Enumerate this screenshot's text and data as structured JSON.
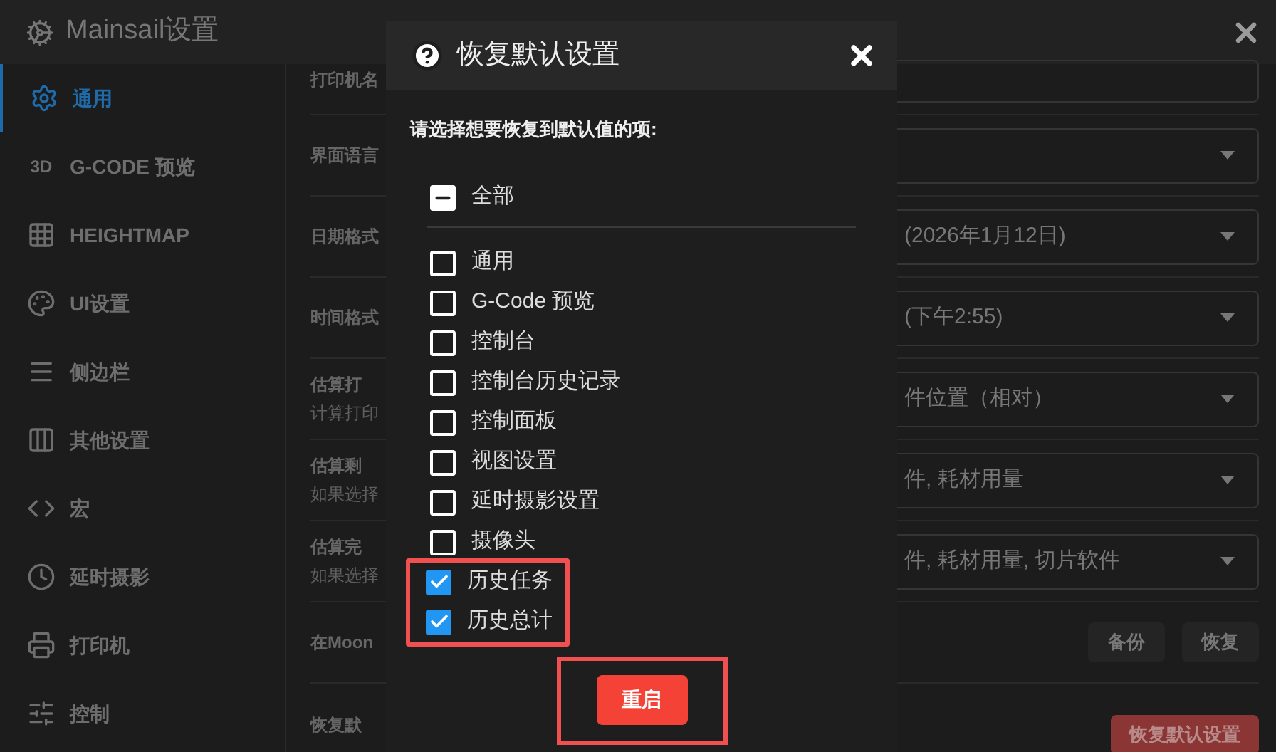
{
  "window": {
    "title": "Mainsail设置"
  },
  "sidebar": {
    "items": [
      {
        "label": "通用",
        "selected": true
      },
      {
        "label": "G-CODE 预览",
        "icon_text": "3D",
        "selected": false
      },
      {
        "label": "HEIGHTMAP",
        "selected": false
      },
      {
        "label": "UI设置",
        "selected": false
      },
      {
        "label": "侧边栏",
        "selected": false
      },
      {
        "label": "其他设置",
        "selected": false
      },
      {
        "label": "宏",
        "selected": false
      },
      {
        "label": "延时摄影",
        "selected": false
      },
      {
        "label": "打印机",
        "selected": false
      },
      {
        "label": "控制",
        "selected": false
      }
    ]
  },
  "settings": {
    "rows": [
      {
        "kind": "text",
        "label": "打印机名"
      },
      {
        "kind": "select",
        "label": "界面语言"
      },
      {
        "kind": "select",
        "label": "日期格式",
        "value": "(2026年1月12日)"
      },
      {
        "kind": "select",
        "label": "时间格式",
        "value": "(下午2:55)"
      },
      {
        "kind": "select",
        "label": "估算打",
        "sublabel": "计算打印",
        "value": "件位置（相对）"
      },
      {
        "kind": "select",
        "label": "估算剩",
        "sublabel": "如果选择",
        "value": "件, 耗材用量"
      },
      {
        "kind": "select",
        "label": "估算完",
        "sublabel": "如果选择",
        "value": "件, 耗材用量, 切片软件"
      },
      {
        "kind": "buttons",
        "label": "在Moon",
        "buttons": [
          "备份",
          "恢复"
        ]
      },
      {
        "kind": "danger",
        "label": "恢复默",
        "buttons": [
          "恢复默认设置"
        ]
      }
    ]
  },
  "dialog": {
    "title": "恢复默认设置",
    "prompt": "请选择想要恢复到默认值的项:",
    "all": {
      "label": "全部",
      "indeterminate": true
    },
    "items": [
      {
        "label": "通用",
        "checked": false,
        "highlighted": false
      },
      {
        "label": "G-Code 预览",
        "checked": false,
        "highlighted": false
      },
      {
        "label": "控制台",
        "checked": false,
        "highlighted": false
      },
      {
        "label": "控制台历史记录",
        "checked": false,
        "highlighted": false
      },
      {
        "label": "控制面板",
        "checked": false,
        "highlighted": false
      },
      {
        "label": "视图设置",
        "checked": false,
        "highlighted": false
      },
      {
        "label": "延时摄影设置",
        "checked": false,
        "highlighted": false
      },
      {
        "label": "摄像头",
        "checked": false,
        "highlighted": false
      },
      {
        "label": "历史任务",
        "checked": true,
        "highlighted": true
      },
      {
        "label": "历史总计",
        "checked": true,
        "highlighted": true
      }
    ],
    "button": {
      "label": "重启",
      "highlighted": true
    }
  }
}
